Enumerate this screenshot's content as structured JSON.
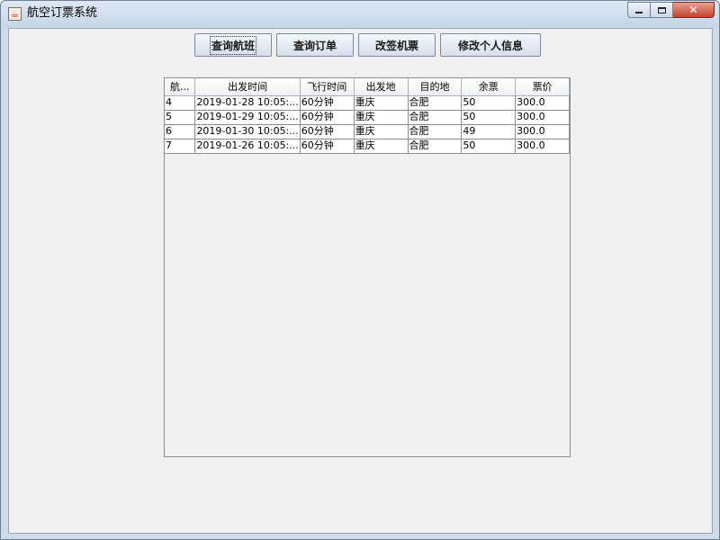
{
  "window": {
    "title": "航空订票系统",
    "icon": "java-cup-icon",
    "controls": {
      "minimize": "minimize-icon",
      "maximize": "maximize-icon",
      "close": "✕"
    }
  },
  "toolbar": {
    "buttons": [
      {
        "label": "查询航班"
      },
      {
        "label": "查询订单"
      },
      {
        "label": "改签机票"
      },
      {
        "label": "修改个人信息"
      }
    ]
  },
  "table": {
    "columns": [
      "航...",
      "出发时间",
      "飞行时间",
      "出发地",
      "目的地",
      "余票",
      "票价"
    ],
    "rows": [
      [
        "4",
        "2019-01-28 10:05:...",
        "60分钟",
        "重庆",
        "合肥",
        "50",
        "300.0"
      ],
      [
        "5",
        "2019-01-29 10:05:...",
        "60分钟",
        "重庆",
        "合肥",
        "50",
        "300.0"
      ],
      [
        "6",
        "2019-01-30 10:05:...",
        "60分钟",
        "重庆",
        "合肥",
        "49",
        "300.0"
      ],
      [
        "7",
        "2019-01-26 10:05:...",
        "60分钟",
        "重庆",
        "合肥",
        "50",
        "300.0"
      ]
    ]
  },
  "colors": {
    "titlebar": "#cfdbe8",
    "content_bg": "#f0f0f0",
    "close_button": "#c2422e"
  }
}
